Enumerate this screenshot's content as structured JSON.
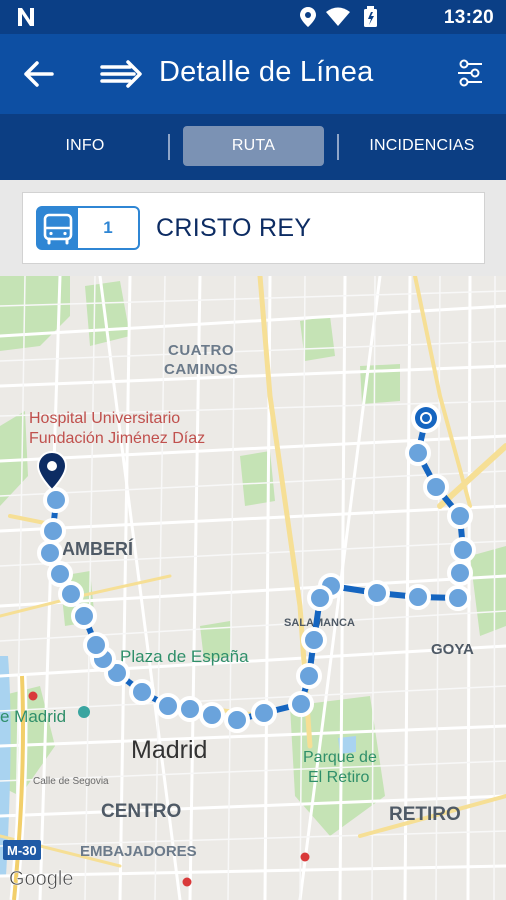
{
  "status_bar": {
    "time": "13:20",
    "icons": [
      "notification-n-icon",
      "location-icon",
      "wifi-icon",
      "battery-icon"
    ]
  },
  "header": {
    "title": "Detalle de Línea"
  },
  "tabs": [
    {
      "label": "INFO",
      "selected": false
    },
    {
      "label": "RUTA",
      "selected": true
    },
    {
      "label": "INCIDENCIAS",
      "selected": false
    }
  ],
  "line": {
    "number": "1",
    "name": "CRISTO REY"
  },
  "map": {
    "labels": {
      "cuatro_caminos_1": "CUATRO",
      "cuatro_caminos_2": "CAMINOS",
      "hospital_1": "Hospital Universitario",
      "hospital_2": "Fundación Jiménez Díaz",
      "chamberi": "AMBERÍ",
      "salamanca": "SALAMANCA",
      "goya": "GOYA",
      "plaza_espana": "Plaza de España",
      "madrid_station": "e Madrid",
      "madrid": "Madrid",
      "retiro_park_1": "Parque de",
      "retiro_park_2": "El Retiro",
      "calle_segovia": "Calle de Segovia",
      "centro": "CENTRO",
      "retiro": "RETIRO",
      "embajadores": "EMBAJADORES",
      "m30": "M-30",
      "google": "Google"
    },
    "colors": {
      "route": "#1565c0",
      "stop_fill": "#6aa3dc",
      "park": "#c5e3b5",
      "water": "#a9d3f0",
      "road": "#ffffff",
      "major_road": "#f6df95"
    }
  }
}
